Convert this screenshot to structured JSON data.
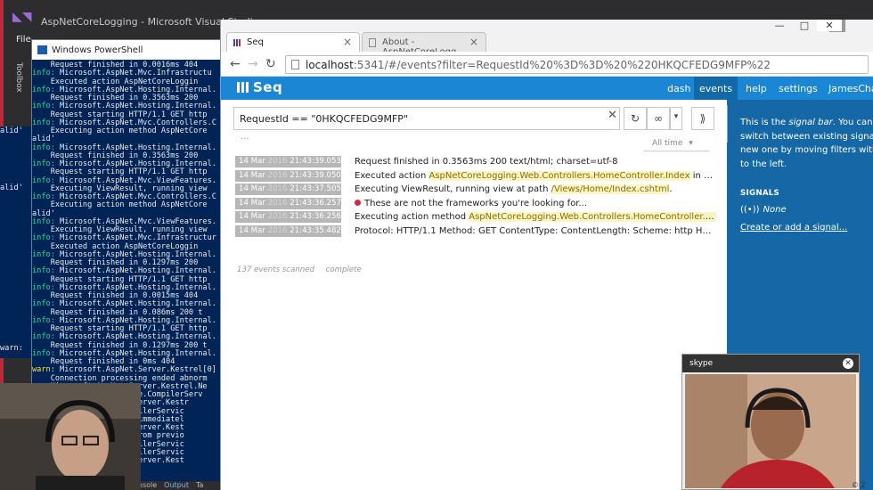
{
  "vs": {
    "title": "AspNetCoreLogging - Microsoft Visual Studio",
    "menu": "File",
    "toolbox": "Toolbox",
    "bottom_tabs": [
      "onsole",
      "Output",
      "Ta"
    ]
  },
  "powershell": {
    "title": "Windows PowerShell",
    "lines": [
      {
        "type": "plain",
        "text": "    Request finished in 0.0016ms 404"
      },
      {
        "type": "info",
        "text": "info: ",
        "rest": "Microsoft.AspNet.Mvc.Infrastructu"
      },
      {
        "type": "plain",
        "text": "    Executed action AspNetCoreLoggin"
      },
      {
        "type": "info",
        "text": "info: ",
        "rest": "Microsoft.AspNet.Hosting.Internal."
      },
      {
        "type": "plain",
        "text": "    Request finished in 0.3563ms 200"
      },
      {
        "type": "info",
        "text": "info: ",
        "rest": "Microsoft.AspNet.Hosting.Internal."
      },
      {
        "type": "plain",
        "text": "    Request starting HTTP/1.1 GET http"
      },
      {
        "type": "info",
        "text": "info: ",
        "rest": "Microsoft.AspNet.Mvc.Controllers.C"
      },
      {
        "type": "plain",
        "text": "    Executing action method AspNetCore"
      },
      {
        "type": "plain",
        "text": "alid'"
      },
      {
        "type": "info",
        "text": "info: ",
        "rest": "Microsoft.AspNet.Hosting.Internal."
      },
      {
        "type": "plain",
        "text": "    Request finished in 0.3563ms 200"
      },
      {
        "type": "info",
        "text": "info: ",
        "rest": "Microsoft.AspNet.Hosting.Internal."
      },
      {
        "type": "plain",
        "text": "    Request starting HTTP/1.1 GET http"
      },
      {
        "type": "info",
        "text": "info: ",
        "rest": "Microsoft.AspNet.Mvc.ViewFeatures."
      },
      {
        "type": "plain",
        "text": "    Executing ViewResult, running view"
      },
      {
        "type": "info",
        "text": "info: ",
        "rest": "Microsoft.AspNet.Mvc.Controllers.C"
      },
      {
        "type": "plain",
        "text": "    Executing action method AspNetCore"
      },
      {
        "type": "plain",
        "text": "alid'"
      },
      {
        "type": "info",
        "text": "info: ",
        "rest": "Microsoft.AspNet.Mvc.ViewFeatures."
      },
      {
        "type": "plain",
        "text": "    Executing ViewResult, running view"
      },
      {
        "type": "info",
        "text": "info: ",
        "rest": "Microsoft.AspNet.Mvc.Infrastructur"
      },
      {
        "type": "plain",
        "text": "    Executed action AspNetCoreLoggin"
      },
      {
        "type": "info",
        "text": "info: ",
        "rest": "Microsoft.AspNet.Hosting.Internal."
      },
      {
        "type": "plain",
        "text": "    Request finished in 0.1297ms 200"
      },
      {
        "type": "info",
        "text": "info: ",
        "rest": "Microsoft.AspNet.Hosting.Internal."
      },
      {
        "type": "plain",
        "text": "    Request starting HTTP/1.1 GET http"
      },
      {
        "type": "info",
        "text": "info: ",
        "rest": "Microsoft.AspNet.Hosting.Internal."
      },
      {
        "type": "plain",
        "text": "    Request finished in 0.0015ms 404"
      },
      {
        "type": "info",
        "text": "info: ",
        "rest": "Microsoft.AspNet.Hosting.Internal."
      },
      {
        "type": "plain",
        "text": "    Request finished in 0.086ms 200 t"
      },
      {
        "type": "info",
        "text": "info: ",
        "rest": "Microsoft.AspNet.Hosting.Internal."
      },
      {
        "type": "plain",
        "text": "    Request starting HTTP/1.1 GET http"
      },
      {
        "type": "info",
        "text": "info: ",
        "rest": "Microsoft.AspNet.Hosting.Internal."
      },
      {
        "type": "plain",
        "text": "    Request finished in 0.1297ms 200 t"
      },
      {
        "type": "info",
        "text": "info: ",
        "rest": "Microsoft.AspNet.Hosting.Internal."
      },
      {
        "type": "plain",
        "text": "    Request finished in 0ms 404"
      },
      {
        "type": "warn",
        "text": "warn: ",
        "rest": "Microsoft.AspNet.Server.Kestrel[0]"
      },
      {
        "type": "plain",
        "text": "    Connection processing ended abnorm"
      },
      {
        "type": "plain",
        "text": "    Microsoft.AspNet.Server.Kestrel.Ne"
      },
      {
        "type": "plain",
        "text": "       at System.Runtime.CompilerServ"
      },
      {
        "type": "plain",
        "text": "                 pNet.Server.Kestr"
      },
      {
        "type": "plain",
        "text": "                 e.CompilerServic"
      },
      {
        "type": "plain",
        "text": "                 olean immediatel"
      },
      {
        "type": "plain",
        "text": "                 pNet.Server.Kest"
      },
      {
        "type": "plain",
        "text": "                 race from previo"
      },
      {
        "type": "plain",
        "text": "                 e.CompilerServic"
      },
      {
        "type": "plain",
        "text": "                 e.CompilerServic"
      },
      {
        "type": "plain",
        "text": "                 pNet.Server.Kest"
      }
    ]
  },
  "chrome": {
    "tabs": [
      {
        "label": "Seq",
        "active": true
      },
      {
        "label": "About - AspNetCoreLogg",
        "active": false
      }
    ],
    "window_controls": [
      "—",
      "□",
      "✕"
    ],
    "url_host": "localhost",
    "url_rest": ":5341/#/events?filter=RequestId%20%3D%3D%20%220HKQCFEDG9MFP%22"
  },
  "seq": {
    "logo": "Seq",
    "nav": [
      {
        "label": "dash",
        "active": false
      },
      {
        "label": "events",
        "active": true
      },
      {
        "label": "help",
        "active": false
      },
      {
        "label": "settings",
        "active": false
      },
      {
        "label": "JamesCha",
        "active": false
      }
    ],
    "query": "RequestId == \"0HKQCFEDG9MFP\"",
    "query_clear": "✕",
    "buttons": {
      "refresh": "↻",
      "tail": "∞",
      "dropdown": "▾",
      "signal_toggle": "⟫"
    },
    "ellipsis": "...",
    "time_range": "All time",
    "time_range_caret": "▾",
    "events": [
      {
        "date": "14 Mar",
        "year": "2016",
        "time": "21:43:39.053",
        "pre": "Request finished in 0.3563ms 200 text/html; charset=utf-8",
        "hl": "",
        "post": "",
        "error": false
      },
      {
        "date": "14 Mar",
        "year": "2016",
        "time": "21:43:39.050",
        "pre": "Executed action ",
        "hl": "AspNetCoreLogging.Web.Controllers.HomeController.Index",
        "post": " in 0.27...",
        "error": false
      },
      {
        "date": "14 Mar",
        "year": "2016",
        "time": "21:43:37.505",
        "pre": "Executing ViewResult, running view at path ",
        "hl": "/Views/Home/Index.cshtml",
        "post": ".",
        "error": false
      },
      {
        "date": "14 Mar",
        "year": "2016",
        "time": "21:43:36.257",
        "pre": "These are not the frameworks you're looking for...",
        "hl": "",
        "post": "",
        "error": true
      },
      {
        "date": "14 Mar",
        "year": "2016",
        "time": "21:43:36.256",
        "pre": "Executing action method ",
        "hl": "AspNetCoreLogging.Web.Controllers.HomeController.Ind...",
        "post": "",
        "error": false
      },
      {
        "date": "14 Mar",
        "year": "2016",
        "time": "21:43:35.482",
        "pre": "Protocol: HTTP/1.1 Method: GET ContentType: ContentLength: Scheme: http Host: ...",
        "hl": "",
        "post": "",
        "error": false
      }
    ],
    "scanned": "137 events scanned",
    "status": "complete",
    "signal_bar": {
      "intro_1a": "This is the ",
      "intro_1b": "signal bar",
      "intro_1c": ". You can a",
      "intro_2": "switch between existing signals",
      "intro_3": "new one by moving filters with t",
      "intro_4": "to the left.",
      "heading": "SIGNALS",
      "none": "None",
      "create": "Create or add a signal..."
    }
  },
  "skype": {
    "title": "skype",
    "close": "✕",
    "copyright": "© 2"
  },
  "colors": {
    "seq_blue": "#1a86d4",
    "signal_blue": "#1567a6",
    "ps_blue": "#012456",
    "error_red": "#d9263f"
  }
}
